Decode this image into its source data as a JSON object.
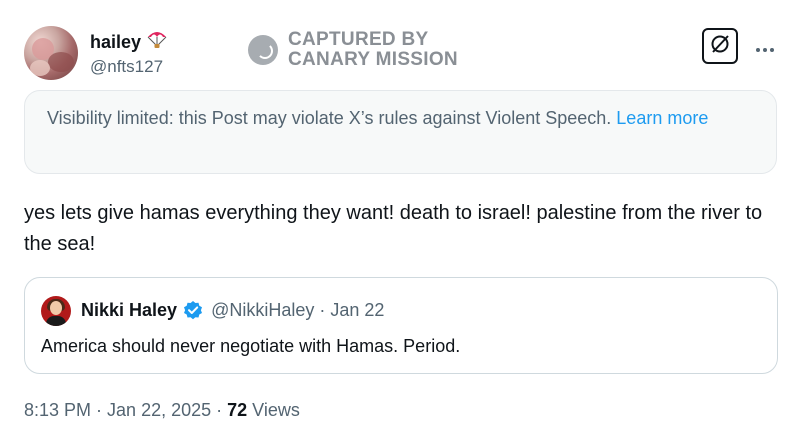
{
  "author": {
    "display_name": "hailey",
    "name_emoji": "parachute-emoji",
    "handle": "@nfts127"
  },
  "watermark": {
    "line1": "CAPTURED BY",
    "line2": "CANARY MISSION"
  },
  "notice": {
    "text": "Visibility limited: this Post may violate X’s rules against Violent Speech.",
    "link_text": "Learn more"
  },
  "tweet": {
    "text": "yes lets give hamas everything they want! death to israel! palestine from the river to the sea!"
  },
  "quote": {
    "name": "Nikki Haley",
    "handle": "@NikkiHaley",
    "separator": "·",
    "date": "Jan 22",
    "text": "America should never negotiate with Hamas. Period."
  },
  "meta": {
    "time": "8:13 PM",
    "separator": "·",
    "date": "Jan 22, 2025",
    "views_count": "72",
    "views_label": "Views"
  },
  "icons": {
    "grok": "grok-icon",
    "more": "more-dots-icon",
    "verified": "verified-badge-icon",
    "watermark": "canary-seal-icon"
  },
  "colors": {
    "link": "#1d9bf0",
    "secondary_text": "#536471",
    "primary_text": "#0f1419",
    "notice_bg": "#f7f9f9",
    "verified": "#1d9bf0"
  }
}
